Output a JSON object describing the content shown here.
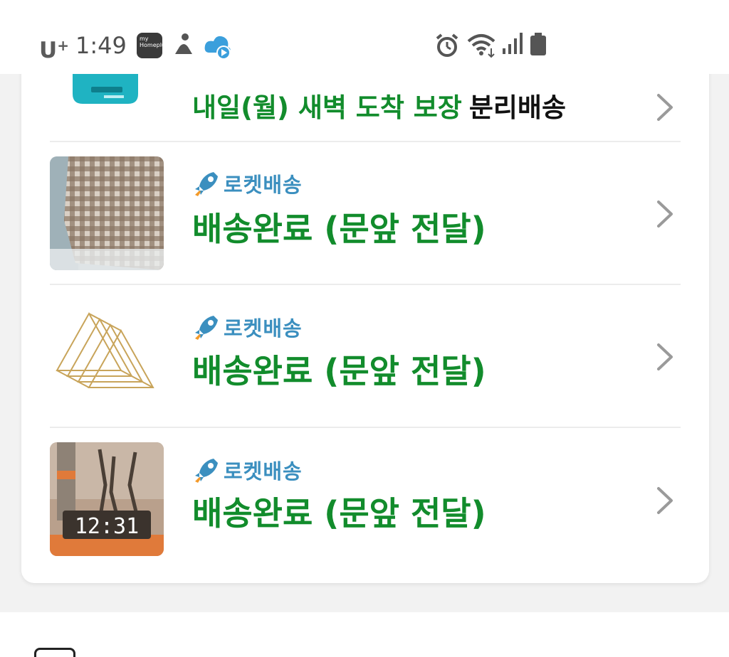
{
  "status_bar": {
    "carrier": "U",
    "carrier_sup": "+",
    "time": "1:49",
    "app_badge": "my Homeplus"
  },
  "shipments": {
    "top_partial": {
      "guarantee_text": "내일(월) 새벽 도착 보장",
      "separate_text": "분리배송"
    },
    "items": [
      {
        "tag": "로켓배송",
        "status": "배송완료 (문앞 전달)",
        "thumb_icon": "checkered-blanket-image"
      },
      {
        "tag": "로켓배송",
        "status": "배송완료 (문앞 전달)",
        "thumb_icon": "gold-wire-rack-image"
      },
      {
        "tag": "로켓배송",
        "status": "배송완료 (문앞 전달)",
        "thumb_icon": "led-clock-image"
      }
    ]
  },
  "colors": {
    "status_green": "#128c2c",
    "rocket_blue": "#3b8fbf",
    "page_bg": "#f2f2f2"
  }
}
